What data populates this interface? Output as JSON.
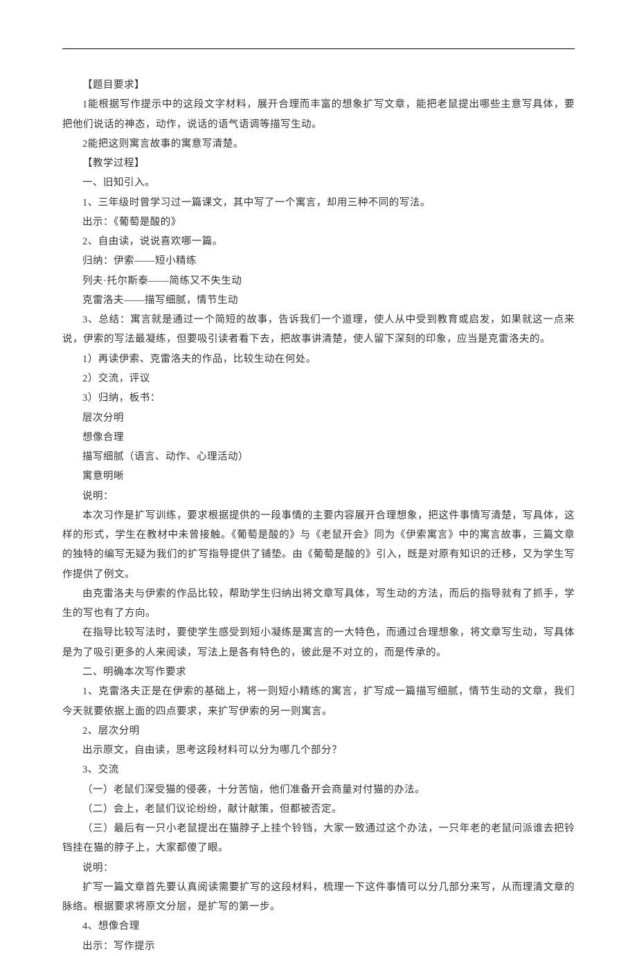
{
  "lines": [
    "【题目要求】",
    "1能根据写作提示中的这段文字材料，展开合理而丰富的想象扩写文章，能把老鼠提出哪些主意写具体，要把他们说话的神态，动作，说话的语气语调等描写生动。",
    "2能把这则寓言故事的寓意写清楚。",
    "【教学过程】",
    "一、旧知引入。",
    "1、三年级时曾学习过一篇课文，其中写了一个寓言，却用三种不同的写法。",
    "出示：《葡萄是酸的》",
    "2、自由读，说说喜欢哪一篇。",
    "归纳：伊索——短小精练",
    "列夫·托尔斯泰——简练又不失生动",
    "克雷洛夫——描写细腻，情节生动",
    "3、总结：寓言就是通过一个简短的故事，告诉我们一个道理，使人从中受到教育或启发，如果就这一点来说，伊索的写法最凝练，但要吸引读者看下去，把故事讲清楚，使人留下深刻的印象，应当是克雷洛夫的。",
    "1）再读伊索、克雷洛夫的作品，比较生动在何处。",
    "2）交流，评议",
    "3）归纳，板书：",
    "层次分明",
    "想像合理",
    "描写细腻（语言、动作、心理活动）",
    "寓意明晰",
    "说明：",
    "本次习作是扩写训练，要求根据提供的一段事情的主要内容展开合理想象，把这件事情写清楚，写具体，这样的形式，学生在教材中未曾接触。《葡萄是酸的》与《老鼠开会》同为《伊索寓言》中的寓言故事，三篇文章的独特的编写无疑为我们的扩写指导提供了铺垫。由《葡萄是酸的》引入，既是对原有知识的迁移，又为学生写作提供了例文。",
    "由克雷洛夫与伊索的作品比较，帮助学生归纳出将文章写具体，写生动的方法，而后的指导就有了抓手，学生的写也有了方向。",
    "在指导比较写法时，要使学生感受到短小凝练是寓言的一大特色，而通过合理想象，将文章写生动，写具体是为了吸引更多的人来阅读，写法上是各有特色的，彼此是不对立的，而是传承的。",
    "二、明确本次写作要求",
    "1、克雷洛夫正是在伊索的基础上，将一则短小精练的寓言，扩写成一篇描写细腻，情节生动的文章，我们今天就要依据上面的四点要求，来扩写伊索的另一则寓言。",
    "2、层次分明",
    "出示原文，自由读，思考这段材料可以分为哪几个部分？",
    "3、交流",
    "（一）老鼠们深受猫的侵袭，十分苦恼，他们准备开会商量对付猫的办法。",
    "（二）会上，老鼠们议论纷纷，献计献策，但都被否定。",
    "（三）最后有一只小老鼠提出在猫脖子上挂个铃铛，大家一致通过这个办法，一只年老的老鼠问派谁去把铃铛挂在猫的脖子上，大家都傻了眼。",
    "说明：",
    "扩写一篇文章首先要认真阅读需要扩写的这段材料，梳理一下这件事情可以分几部分来写，从而理清文章的脉络。根据要求将原文分层，是扩写的第一步。",
    "4、想像合理",
    "出示：写作提示"
  ]
}
